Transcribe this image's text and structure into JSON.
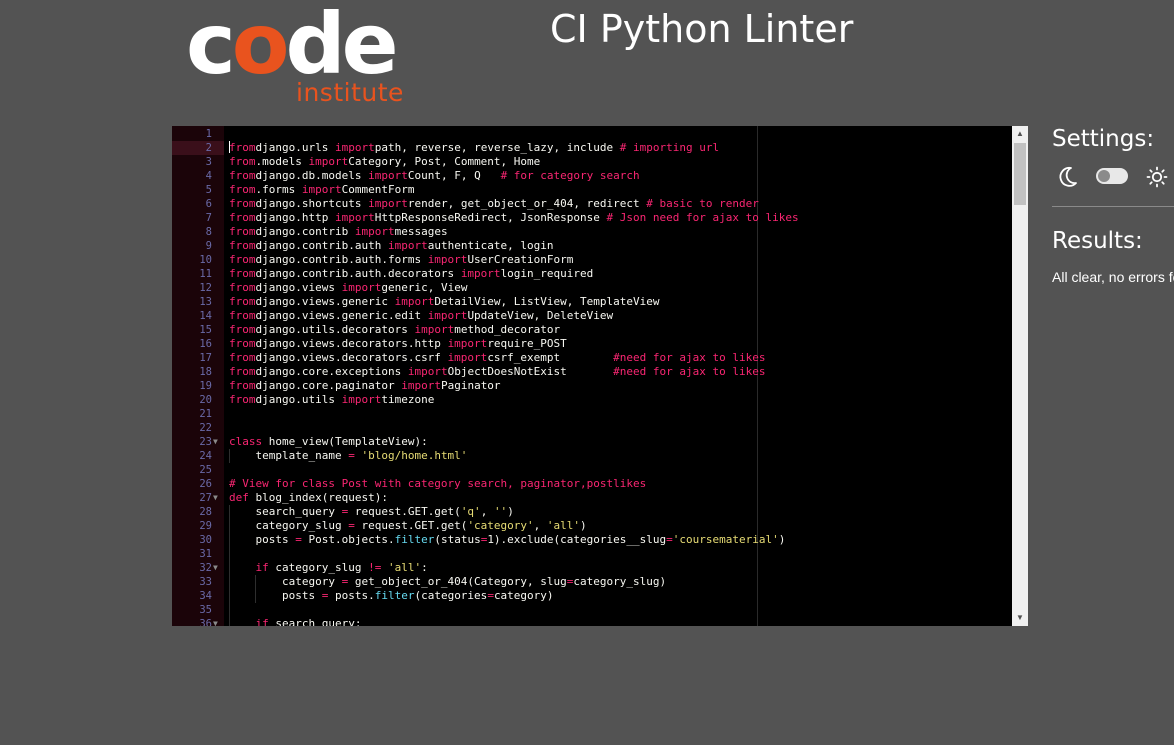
{
  "header": {
    "logo": {
      "word": "code",
      "sub": "institute"
    },
    "title": "CI Python Linter"
  },
  "editor": {
    "active_line": 2,
    "lines": [
      {
        "n": "1",
        "fold": false,
        "t": []
      },
      {
        "n": "2",
        "fold": false,
        "t": [
          [
            "kw",
            "from"
          ],
          [
            "",
            "django.urls "
          ],
          [
            "kw",
            "import"
          ],
          [
            "",
            "path, reverse, reverse_lazy, include "
          ],
          [
            "cm",
            "# importing url"
          ]
        ]
      },
      {
        "n": "3",
        "fold": false,
        "t": [
          [
            "kw",
            "from"
          ],
          [
            "",
            ".models "
          ],
          [
            "kw",
            "import"
          ],
          [
            "",
            "Category, Post, Comment, Home"
          ]
        ]
      },
      {
        "n": "4",
        "fold": false,
        "t": [
          [
            "kw",
            "from"
          ],
          [
            "",
            "django.db.models "
          ],
          [
            "kw",
            "import"
          ],
          [
            "",
            "Count, F, Q   "
          ],
          [
            "cm",
            "# for category search"
          ]
        ]
      },
      {
        "n": "5",
        "fold": false,
        "t": [
          [
            "kw",
            "from"
          ],
          [
            "",
            ".forms "
          ],
          [
            "kw",
            "import"
          ],
          [
            "",
            "CommentForm"
          ]
        ]
      },
      {
        "n": "6",
        "fold": false,
        "t": [
          [
            "kw",
            "from"
          ],
          [
            "",
            "django.shortcuts "
          ],
          [
            "kw",
            "import"
          ],
          [
            "",
            "render, get_object_or_404, redirect "
          ],
          [
            "cm",
            "# basic to render"
          ]
        ]
      },
      {
        "n": "7",
        "fold": false,
        "t": [
          [
            "kw",
            "from"
          ],
          [
            "",
            "django.http "
          ],
          [
            "kw",
            "import"
          ],
          [
            "",
            "HttpResponseRedirect, JsonResponse "
          ],
          [
            "cm",
            "# Json need for ajax to likes"
          ]
        ]
      },
      {
        "n": "8",
        "fold": false,
        "t": [
          [
            "kw",
            "from"
          ],
          [
            "",
            "django.contrib "
          ],
          [
            "kw",
            "import"
          ],
          [
            "",
            "messages"
          ]
        ]
      },
      {
        "n": "9",
        "fold": false,
        "t": [
          [
            "kw",
            "from"
          ],
          [
            "",
            "django.contrib.auth "
          ],
          [
            "kw",
            "import"
          ],
          [
            "",
            "authenticate, login"
          ]
        ]
      },
      {
        "n": "10",
        "fold": false,
        "t": [
          [
            "kw",
            "from"
          ],
          [
            "",
            "django.contrib.auth.forms "
          ],
          [
            "kw",
            "import"
          ],
          [
            "",
            "UserCreationForm"
          ]
        ]
      },
      {
        "n": "11",
        "fold": false,
        "t": [
          [
            "kw",
            "from"
          ],
          [
            "",
            "django.contrib.auth.decorators "
          ],
          [
            "kw",
            "import"
          ],
          [
            "",
            "login_required"
          ]
        ]
      },
      {
        "n": "12",
        "fold": false,
        "t": [
          [
            "kw",
            "from"
          ],
          [
            "",
            "django.views "
          ],
          [
            "kw",
            "import"
          ],
          [
            "",
            "generic, View"
          ]
        ]
      },
      {
        "n": "13",
        "fold": false,
        "t": [
          [
            "kw",
            "from"
          ],
          [
            "",
            "django.views.generic "
          ],
          [
            "kw",
            "import"
          ],
          [
            "",
            "DetailView, ListView, TemplateView"
          ]
        ]
      },
      {
        "n": "14",
        "fold": false,
        "t": [
          [
            "kw",
            "from"
          ],
          [
            "",
            "django.views.generic.edit "
          ],
          [
            "kw",
            "import"
          ],
          [
            "",
            "UpdateView, DeleteView"
          ]
        ]
      },
      {
        "n": "15",
        "fold": false,
        "t": [
          [
            "kw",
            "from"
          ],
          [
            "",
            "django.utils.decorators "
          ],
          [
            "kw",
            "import"
          ],
          [
            "",
            "method_decorator"
          ]
        ]
      },
      {
        "n": "16",
        "fold": false,
        "t": [
          [
            "kw",
            "from"
          ],
          [
            "",
            "django.views.decorators.http "
          ],
          [
            "kw",
            "import"
          ],
          [
            "",
            "require_POST"
          ]
        ]
      },
      {
        "n": "17",
        "fold": false,
        "t": [
          [
            "kw",
            "from"
          ],
          [
            "",
            "django.views.decorators.csrf "
          ],
          [
            "kw",
            "import"
          ],
          [
            "",
            "csrf_exempt        "
          ],
          [
            "cm",
            "#need for ajax to likes"
          ]
        ]
      },
      {
        "n": "18",
        "fold": false,
        "t": [
          [
            "kw",
            "from"
          ],
          [
            "",
            "django.core.exceptions "
          ],
          [
            "kw",
            "import"
          ],
          [
            "",
            "ObjectDoesNotExist       "
          ],
          [
            "cm",
            "#need for ajax to likes"
          ]
        ]
      },
      {
        "n": "19",
        "fold": false,
        "t": [
          [
            "kw",
            "from"
          ],
          [
            "",
            "django.core.paginator "
          ],
          [
            "kw",
            "import"
          ],
          [
            "",
            "Paginator"
          ]
        ]
      },
      {
        "n": "20",
        "fold": false,
        "t": [
          [
            "kw",
            "from"
          ],
          [
            "",
            "django.utils "
          ],
          [
            "kw",
            "import"
          ],
          [
            "",
            "timezone"
          ]
        ]
      },
      {
        "n": "21",
        "fold": false,
        "t": []
      },
      {
        "n": "22",
        "fold": false,
        "t": []
      },
      {
        "n": "23",
        "fold": true,
        "t": [
          [
            "kw",
            "class"
          ],
          [
            "",
            " home_view(TemplateView):"
          ]
        ]
      },
      {
        "n": "24",
        "fold": false,
        "t": [
          [
            "",
            "    template_name "
          ],
          [
            "op",
            "="
          ],
          [
            "",
            " "
          ],
          [
            "st",
            "'blog/home.html'"
          ]
        ]
      },
      {
        "n": "25",
        "fold": false,
        "t": []
      },
      {
        "n": "26",
        "fold": false,
        "t": [
          [
            "cm",
            "# View for class Post with category search, paginator,postlikes"
          ]
        ]
      },
      {
        "n": "27",
        "fold": true,
        "t": [
          [
            "kw",
            "def"
          ],
          [
            "",
            " blog_index(request):"
          ]
        ]
      },
      {
        "n": "28",
        "fold": false,
        "t": [
          [
            "",
            "    search_query "
          ],
          [
            "op",
            "="
          ],
          [
            "",
            " request.GET.get("
          ],
          [
            "st",
            "'q'"
          ],
          [
            "",
            ", "
          ],
          [
            "st",
            "''"
          ],
          [
            "",
            ")"
          ]
        ]
      },
      {
        "n": "29",
        "fold": false,
        "t": [
          [
            "",
            "    category_slug "
          ],
          [
            "op",
            "="
          ],
          [
            "",
            " request.GET.get("
          ],
          [
            "st",
            "'category'"
          ],
          [
            "",
            ", "
          ],
          [
            "st",
            "'all'"
          ],
          [
            "",
            ")"
          ]
        ]
      },
      {
        "n": "30",
        "fold": false,
        "t": [
          [
            "",
            "    posts "
          ],
          [
            "op",
            "="
          ],
          [
            "",
            " Post.objects."
          ],
          [
            "fn",
            "filter"
          ],
          [
            "",
            "(status"
          ],
          [
            "op",
            "="
          ],
          [
            "",
            "1).exclude(categories__slug"
          ],
          [
            "op",
            "="
          ],
          [
            "st",
            "'coursematerial'"
          ],
          [
            "",
            ")"
          ]
        ]
      },
      {
        "n": "31",
        "fold": false,
        "t": []
      },
      {
        "n": "32",
        "fold": true,
        "t": [
          [
            "",
            "    "
          ],
          [
            "kw",
            "if"
          ],
          [
            "",
            " category_slug "
          ],
          [
            "op",
            "!="
          ],
          [
            "",
            " "
          ],
          [
            "st",
            "'all'"
          ],
          [
            "",
            ":"
          ]
        ]
      },
      {
        "n": "33",
        "fold": false,
        "t": [
          [
            "",
            "        category "
          ],
          [
            "op",
            "="
          ],
          [
            "",
            " get_object_or_404(Category, slug"
          ],
          [
            "op",
            "="
          ],
          [
            "",
            "category_slug)"
          ]
        ]
      },
      {
        "n": "34",
        "fold": false,
        "t": [
          [
            "",
            "        posts "
          ],
          [
            "op",
            "="
          ],
          [
            "",
            " posts."
          ],
          [
            "fn",
            "filter"
          ],
          [
            "",
            "(categories"
          ],
          [
            "op",
            "="
          ],
          [
            "",
            "category)"
          ]
        ]
      },
      {
        "n": "35",
        "fold": false,
        "t": []
      },
      {
        "n": "36",
        "fold": true,
        "t": [
          [
            "",
            "    "
          ],
          [
            "kw",
            "if"
          ],
          [
            "",
            " search_query:"
          ]
        ]
      }
    ]
  },
  "settings": {
    "title": "Settings:",
    "dark_icon": "moon-icon",
    "light_icon": "sun-icon"
  },
  "results": {
    "title": "Results:",
    "message": "All clear, no errors found"
  }
}
